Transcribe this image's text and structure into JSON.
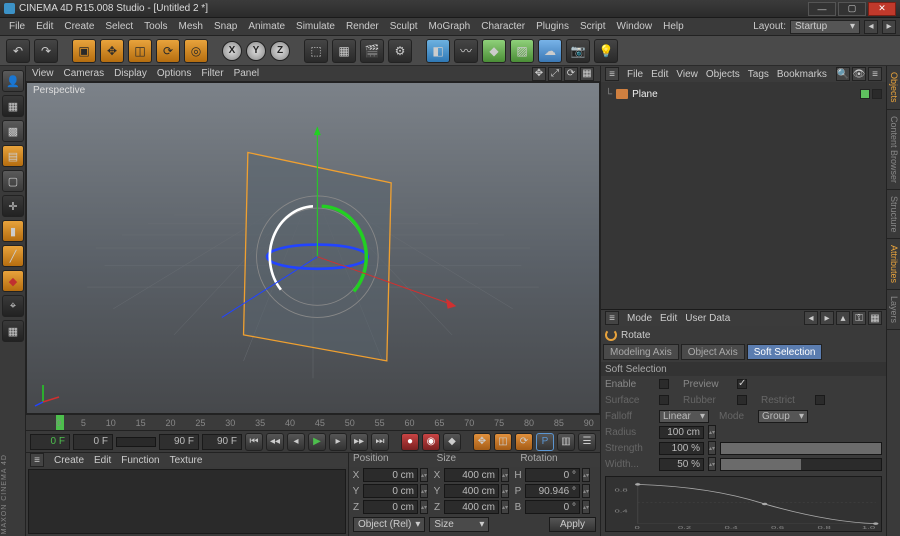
{
  "titlebar": {
    "title": "CINEMA 4D R15.008 Studio - [Untitled 2 *]"
  },
  "menu": [
    "File",
    "Edit",
    "Create",
    "Select",
    "Tools",
    "Mesh",
    "Snap",
    "Animate",
    "Simulate",
    "Render",
    "Sculpt",
    "MoGraph",
    "Character",
    "Plugins",
    "Script",
    "Window",
    "Help"
  ],
  "layout": {
    "label": "Layout:",
    "value": "Startup"
  },
  "axes": [
    "X",
    "Y",
    "Z"
  ],
  "viewport": {
    "menus": [
      "View",
      "Cameras",
      "Display",
      "Options",
      "Filter",
      "Panel"
    ],
    "label": "Perspective"
  },
  "timeline": {
    "ticks": [
      "0",
      "5",
      "10",
      "15",
      "20",
      "25",
      "30",
      "35",
      "40",
      "45",
      "50",
      "55",
      "60",
      "65",
      "70",
      "75",
      "80",
      "85",
      "90"
    ]
  },
  "transport": {
    "cur": "0 F",
    "start": "0 F",
    "end": "90 F",
    "total": "90 F"
  },
  "material": {
    "menus": [
      "Create",
      "Edit",
      "Function",
      "Texture"
    ]
  },
  "coord": {
    "headers": [
      "Position",
      "Size",
      "Rotation"
    ],
    "rows": [
      {
        "a": "X",
        "p": "0 cm",
        "s": "400 cm",
        "rl": "H",
        "r": "0 °"
      },
      {
        "a": "Y",
        "p": "0 cm",
        "s": "400 cm",
        "rl": "P",
        "r": "90.946 °"
      },
      {
        "a": "Z",
        "p": "0 cm",
        "s": "400 cm",
        "rl": "B",
        "r": "0 °"
      }
    ],
    "modeA": "Object (Rel)",
    "modeB": "Size",
    "apply": "Apply"
  },
  "rtabs": [
    "Objects",
    "Content Browser",
    "Structure",
    "Attributes",
    "Layers"
  ],
  "objmgr": {
    "menus": [
      "File",
      "Edit",
      "View",
      "Objects",
      "Tags",
      "Bookmarks"
    ],
    "item": "Plane"
  },
  "attr": {
    "menus": [
      "Mode",
      "Edit",
      "User Data"
    ],
    "title": "Rotate",
    "tabs": [
      "Modeling Axis",
      "Object Axis",
      "Soft Selection"
    ],
    "active_tab": 2,
    "section": "Soft Selection",
    "enable": "Enable",
    "preview": "Preview",
    "surface": "Surface",
    "rubber": "Rubber",
    "restrict": "Restrict",
    "falloff": "Falloff",
    "falloff_val": "Linear",
    "mode": "Mode",
    "mode_val": "Group",
    "radius": "Radius",
    "radius_val": "100 cm",
    "strength": "Strength",
    "strength_val": "100 %",
    "width": "Width...",
    "width_val": "50 %",
    "curve_y": [
      "0.8",
      "0.4"
    ],
    "curve_x": [
      "0",
      "0.2",
      "0.4",
      "0.6",
      "0.8",
      "1.0"
    ]
  },
  "brand": "MAXON CINEMA 4D"
}
